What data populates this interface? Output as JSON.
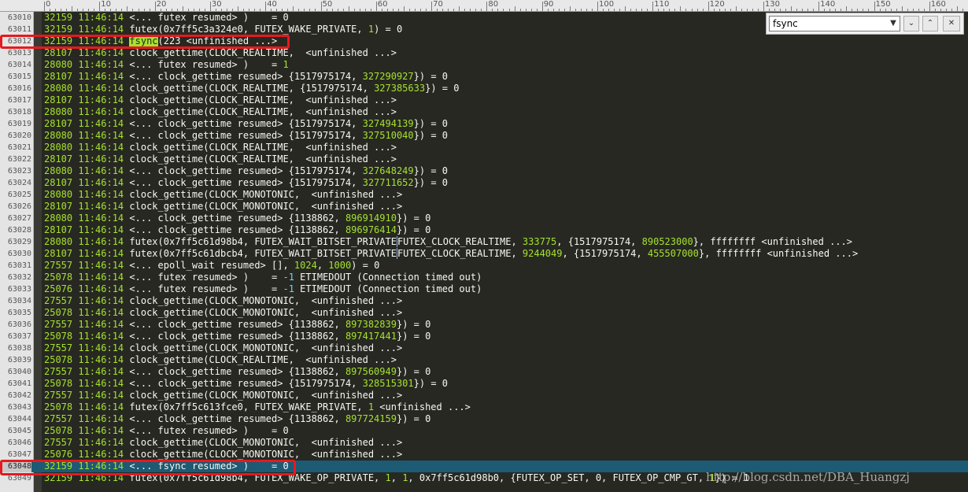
{
  "ruler": {
    "labels": [
      "0",
      "10",
      "20",
      "30",
      "40",
      "50",
      "60",
      "70",
      "80",
      "90",
      "100",
      "110",
      "120",
      "130",
      "140",
      "150",
      "160"
    ]
  },
  "find": {
    "query": "fsync",
    "dropdown_icon": "dropdown-arrow",
    "prev_icon": "chevron-down",
    "next_icon": "chevron-up",
    "close_icon": "close"
  },
  "lines": [
    {
      "n": "63010",
      "c": [
        [
          "pid",
          "32159 "
        ],
        [
          "tm",
          "11:46:14 "
        ],
        [
          "",
          "<... futex resumed> )    = 0"
        ]
      ]
    },
    {
      "n": "63011",
      "c": [
        [
          "pid",
          "32159 "
        ],
        [
          "tm",
          "11:46:14 "
        ],
        [
          "",
          "futex(0x7ff5c3a324e0, FUTEX_WAKE_PRIVATE, "
        ],
        [
          "num",
          "1"
        ],
        [
          "",
          ") = 0"
        ]
      ]
    },
    {
      "n": "63012",
      "c": [
        [
          "pid",
          "32159 "
        ],
        [
          "tm",
          "11:46:14 "
        ],
        [
          "hl",
          "fsync"
        ],
        [
          "",
          "(223 <unfinished ...>"
        ]
      ]
    },
    {
      "n": "63013",
      "c": [
        [
          "pid",
          "28107 "
        ],
        [
          "tm",
          "11:46:14 "
        ],
        [
          "",
          "clock_gettime(CLOCK_REALTIME,  <unfinished ...>"
        ]
      ]
    },
    {
      "n": "63014",
      "c": [
        [
          "pid",
          "28080 "
        ],
        [
          "tm",
          "11:46:14 "
        ],
        [
          "",
          "<... futex resumed> )    = "
        ],
        [
          "num",
          "1"
        ]
      ]
    },
    {
      "n": "63015",
      "c": [
        [
          "pid",
          "28107 "
        ],
        [
          "tm",
          "11:46:14 "
        ],
        [
          "",
          "<... clock_gettime resumed> {1517975174, "
        ],
        [
          "num",
          "327290927"
        ],
        [
          "",
          "}) = 0"
        ]
      ]
    },
    {
      "n": "63016",
      "c": [
        [
          "pid",
          "28080 "
        ],
        [
          "tm",
          "11:46:14 "
        ],
        [
          "",
          "clock_gettime(CLOCK_REALTIME, {1517975174, "
        ],
        [
          "num",
          "327385633"
        ],
        [
          "",
          "}) = 0"
        ]
      ]
    },
    {
      "n": "63017",
      "c": [
        [
          "pid",
          "28107 "
        ],
        [
          "tm",
          "11:46:14 "
        ],
        [
          "",
          "clock_gettime(CLOCK_REALTIME,  <unfinished ...>"
        ]
      ]
    },
    {
      "n": "63018",
      "c": [
        [
          "pid",
          "28080 "
        ],
        [
          "tm",
          "11:46:14 "
        ],
        [
          "",
          "clock_gettime(CLOCK_REALTIME,  <unfinished ...>"
        ]
      ]
    },
    {
      "n": "63019",
      "c": [
        [
          "pid",
          "28107 "
        ],
        [
          "tm",
          "11:46:14 "
        ],
        [
          "",
          "<... clock_gettime resumed> {1517975174, "
        ],
        [
          "num",
          "327494139"
        ],
        [
          "",
          "}) = 0"
        ]
      ]
    },
    {
      "n": "63020",
      "c": [
        [
          "pid",
          "28080 "
        ],
        [
          "tm",
          "11:46:14 "
        ],
        [
          "",
          "<... clock_gettime resumed> {1517975174, "
        ],
        [
          "num",
          "327510040"
        ],
        [
          "",
          "}) = 0"
        ]
      ]
    },
    {
      "n": "63021",
      "c": [
        [
          "pid",
          "28080 "
        ],
        [
          "tm",
          "11:46:14 "
        ],
        [
          "",
          "clock_gettime(CLOCK_REALTIME,  <unfinished ...>"
        ]
      ]
    },
    {
      "n": "63022",
      "c": [
        [
          "pid",
          "28107 "
        ],
        [
          "tm",
          "11:46:14 "
        ],
        [
          "",
          "clock_gettime(CLOCK_REALTIME,  <unfinished ...>"
        ]
      ]
    },
    {
      "n": "63023",
      "c": [
        [
          "pid",
          "28080 "
        ],
        [
          "tm",
          "11:46:14 "
        ],
        [
          "",
          "<... clock_gettime resumed> {1517975174, "
        ],
        [
          "num",
          "327648249"
        ],
        [
          "",
          "}) = 0"
        ]
      ]
    },
    {
      "n": "63024",
      "c": [
        [
          "pid",
          "28107 "
        ],
        [
          "tm",
          "11:46:14 "
        ],
        [
          "",
          "<... clock_gettime resumed> {1517975174, "
        ],
        [
          "num",
          "327711652"
        ],
        [
          "",
          "}) = 0"
        ]
      ]
    },
    {
      "n": "63025",
      "c": [
        [
          "pid",
          "28080 "
        ],
        [
          "tm",
          "11:46:14 "
        ],
        [
          "",
          "clock_gettime(CLOCK_MONOTONIC,  <unfinished ...>"
        ]
      ]
    },
    {
      "n": "63026",
      "c": [
        [
          "pid",
          "28107 "
        ],
        [
          "tm",
          "11:46:14 "
        ],
        [
          "",
          "clock_gettime(CLOCK_MONOTONIC,  <unfinished ...>"
        ]
      ]
    },
    {
      "n": "63027",
      "c": [
        [
          "pid",
          "28080 "
        ],
        [
          "tm",
          "11:46:14 "
        ],
        [
          "",
          "<... clock_gettime resumed> {1138862, "
        ],
        [
          "num",
          "896914910"
        ],
        [
          "",
          "}) = 0"
        ]
      ]
    },
    {
      "n": "63028",
      "c": [
        [
          "pid",
          "28107 "
        ],
        [
          "tm",
          "11:46:14 "
        ],
        [
          "",
          "<... clock_gettime resumed> {1138862, "
        ],
        [
          "num",
          "896976414"
        ],
        [
          "",
          "}) = 0"
        ]
      ]
    },
    {
      "n": "63029",
      "c": [
        [
          "pid",
          "28080 "
        ],
        [
          "tm",
          "11:46:14 "
        ],
        [
          "",
          "futex(0x7ff5c61d98b4, FUTEX_WAIT_BITSET_PRIVATE"
        ],
        [
          "sep",
          "FUTEX_CLOCK_REALTIME, "
        ],
        [
          "num",
          "333775"
        ],
        [
          "",
          ", {1517975174, "
        ],
        [
          "num",
          "890523000"
        ],
        [
          "",
          "}, ffffffff <unfinished ...>"
        ]
      ]
    },
    {
      "n": "63030",
      "c": [
        [
          "pid",
          "28107 "
        ],
        [
          "tm",
          "11:46:14 "
        ],
        [
          "",
          "futex(0x7ff5c61dbcb4, FUTEX_WAIT_BITSET_PRIVATE"
        ],
        [
          "sep",
          "FUTEX_CLOCK_REALTIME, "
        ],
        [
          "num",
          "9244049"
        ],
        [
          "",
          ", {1517975174, "
        ],
        [
          "num",
          "455507000"
        ],
        [
          "",
          "}, ffffffff <unfinished ...>"
        ]
      ]
    },
    {
      "n": "63031",
      "c": [
        [
          "pid",
          "27557 "
        ],
        [
          "tm",
          "11:46:14 "
        ],
        [
          "",
          "<... epoll_wait resumed> [], "
        ],
        [
          "num",
          "1024"
        ],
        [
          "",
          ", "
        ],
        [
          "num",
          "1000"
        ],
        [
          "",
          ") = 0"
        ]
      ]
    },
    {
      "n": "63032",
      "c": [
        [
          "pid",
          "25078 "
        ],
        [
          "tm",
          "11:46:14 "
        ],
        [
          "",
          "<... futex resumed> )    = "
        ],
        [
          "neg",
          "-1"
        ],
        [
          "",
          " ETIMEDOUT (Connection timed out)"
        ]
      ]
    },
    {
      "n": "63033",
      "c": [
        [
          "pid",
          "25076 "
        ],
        [
          "tm",
          "11:46:14 "
        ],
        [
          "",
          "<... futex resumed> )    = "
        ],
        [
          "neg",
          "-1"
        ],
        [
          "",
          " ETIMEDOUT (Connection timed out)"
        ]
      ]
    },
    {
      "n": "63034",
      "c": [
        [
          "pid",
          "27557 "
        ],
        [
          "tm",
          "11:46:14 "
        ],
        [
          "",
          "clock_gettime(CLOCK_MONOTONIC,  <unfinished ...>"
        ]
      ]
    },
    {
      "n": "63035",
      "c": [
        [
          "pid",
          "25078 "
        ],
        [
          "tm",
          "11:46:14 "
        ],
        [
          "",
          "clock_gettime(CLOCK_MONOTONIC,  <unfinished ...>"
        ]
      ]
    },
    {
      "n": "63036",
      "c": [
        [
          "pid",
          "27557 "
        ],
        [
          "tm",
          "11:46:14 "
        ],
        [
          "",
          "<... clock_gettime resumed> {1138862, "
        ],
        [
          "num",
          "897382839"
        ],
        [
          "",
          "}) = 0"
        ]
      ]
    },
    {
      "n": "63037",
      "c": [
        [
          "pid",
          "25078 "
        ],
        [
          "tm",
          "11:46:14 "
        ],
        [
          "",
          "<... clock_gettime resumed> {1138862, "
        ],
        [
          "num",
          "897417441"
        ],
        [
          "",
          "}) = 0"
        ]
      ]
    },
    {
      "n": "63038",
      "c": [
        [
          "pid",
          "27557 "
        ],
        [
          "tm",
          "11:46:14 "
        ],
        [
          "",
          "clock_gettime(CLOCK_MONOTONIC,  <unfinished ...>"
        ]
      ]
    },
    {
      "n": "63039",
      "c": [
        [
          "pid",
          "25078 "
        ],
        [
          "tm",
          "11:46:14 "
        ],
        [
          "",
          "clock_gettime(CLOCK_REALTIME,  <unfinished ...>"
        ]
      ]
    },
    {
      "n": "63040",
      "c": [
        [
          "pid",
          "27557 "
        ],
        [
          "tm",
          "11:46:14 "
        ],
        [
          "",
          "<... clock_gettime resumed> {1138862, "
        ],
        [
          "num",
          "897560949"
        ],
        [
          "",
          "}) = 0"
        ]
      ]
    },
    {
      "n": "63041",
      "c": [
        [
          "pid",
          "25078 "
        ],
        [
          "tm",
          "11:46:14 "
        ],
        [
          "",
          "<... clock_gettime resumed> {1517975174, "
        ],
        [
          "num",
          "328515301"
        ],
        [
          "",
          "}) = 0"
        ]
      ]
    },
    {
      "n": "63042",
      "c": [
        [
          "pid",
          "27557 "
        ],
        [
          "tm",
          "11:46:14 "
        ],
        [
          "",
          "clock_gettime(CLOCK_MONOTONIC,  <unfinished ...>"
        ]
      ]
    },
    {
      "n": "63043",
      "c": [
        [
          "pid",
          "25078 "
        ],
        [
          "tm",
          "11:46:14 "
        ],
        [
          "",
          "futex(0x7ff5c613fce0, FUTEX_WAKE_PRIVATE, "
        ],
        [
          "num",
          "1"
        ],
        [
          "",
          " <unfinished ...>"
        ]
      ]
    },
    {
      "n": "63044",
      "c": [
        [
          "pid",
          "27557 "
        ],
        [
          "tm",
          "11:46:14 "
        ],
        [
          "",
          "<... clock_gettime resumed> {1138862, "
        ],
        [
          "num",
          "897724159"
        ],
        [
          "",
          "}) = 0"
        ]
      ]
    },
    {
      "n": "63045",
      "c": [
        [
          "pid",
          "25078 "
        ],
        [
          "tm",
          "11:46:14 "
        ],
        [
          "",
          "<... futex resumed> )    = 0"
        ]
      ]
    },
    {
      "n": "63046",
      "c": [
        [
          "pid",
          "27557 "
        ],
        [
          "tm",
          "11:46:14 "
        ],
        [
          "",
          "clock_gettime(CLOCK_MONOTONIC,  <unfinished ...>"
        ]
      ]
    },
    {
      "n": "63047",
      "c": [
        [
          "pid",
          "25076 "
        ],
        [
          "tm",
          "11:46:14 "
        ],
        [
          "",
          "clock_gettime(CLOCK_MONOTONIC,  <unfinished ...>"
        ]
      ]
    },
    {
      "n": "63048",
      "current": true,
      "c": [
        [
          "pid",
          "32159 "
        ],
        [
          "tm",
          "11:46:14 "
        ],
        [
          "",
          "<... fsync resumed> )    = 0"
        ]
      ]
    },
    {
      "n": "63049",
      "c": [
        [
          "pid",
          "32159 "
        ],
        [
          "tm",
          "11:46:14 "
        ],
        [
          "",
          "futex(0x7ff5c61d98b4, FUTEX_WAKE_OP_PRIVATE, "
        ],
        [
          "num",
          "1"
        ],
        [
          "",
          ", "
        ],
        [
          "num",
          "1"
        ],
        [
          "",
          ", 0x7ff5c61d98b0, {FUTEX_OP_SET, 0, FUTEX_OP_CMP_GT, "
        ],
        [
          "num",
          "1"
        ],
        [
          "",
          "}) = 1"
        ]
      ]
    }
  ],
  "watermark": "http://blog.csdn.net/DBA_Huangzj"
}
